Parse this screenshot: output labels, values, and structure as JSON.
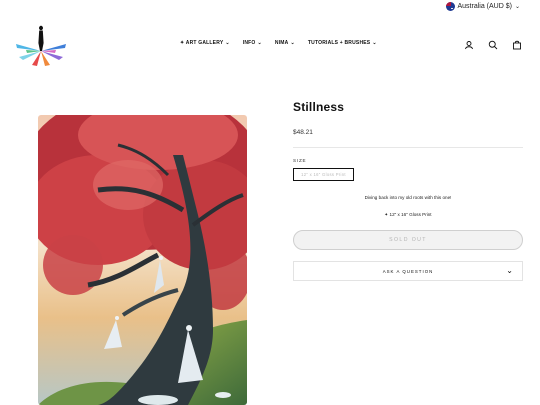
{
  "locale": {
    "label": "Australia (AUD $)",
    "flag_icon": "australia-flag-icon"
  },
  "nav": {
    "items": [
      {
        "label": "✦ ART GALLERY"
      },
      {
        "label": "INFO"
      },
      {
        "label": "NIMA"
      },
      {
        "label": "TUTORIALS + BRUSHES"
      }
    ]
  },
  "header_icons": [
    "account-icon",
    "search-icon",
    "cart-icon"
  ],
  "product": {
    "title": "Stillness",
    "price": "$48.21",
    "size_label": "SIZE",
    "size_option": "12\" x 16\" Gloss Print",
    "description": "Diving back into my old roots with this one!",
    "spec": "✦ 12\" x 16\" Gloss Print",
    "button_label": "SOLD OUT",
    "ask_label": "ASK A QUESTION"
  },
  "colors": {
    "accent": "#111111",
    "sold_out_bg": "#f2f2f2",
    "tree_red": "#c7383c"
  }
}
